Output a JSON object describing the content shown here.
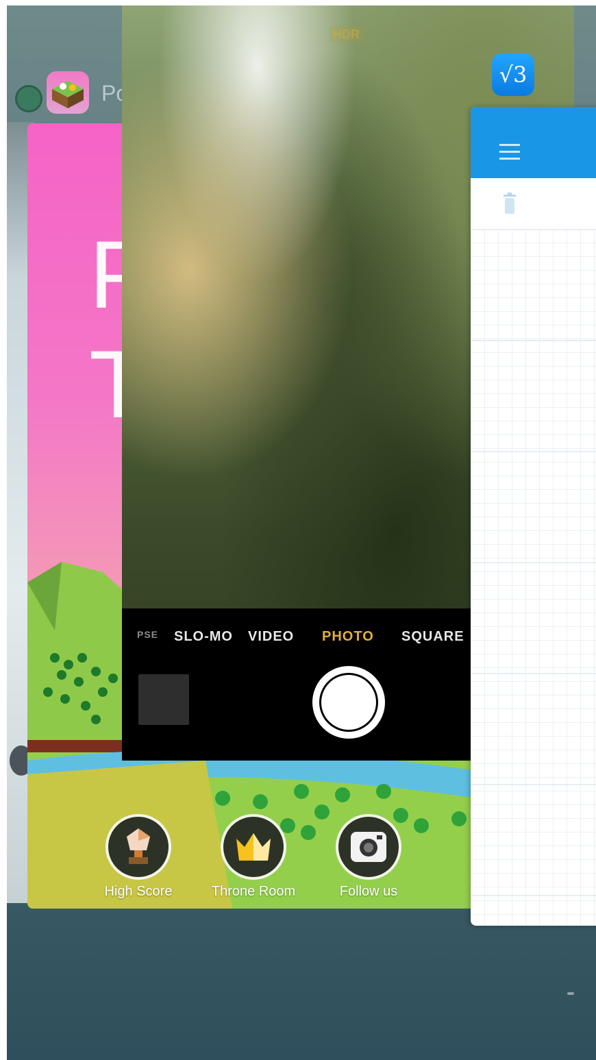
{
  "switcher": {
    "game_app": {
      "name": "Po",
      "title_lines": [
        "P",
        "T"
      ],
      "buttons": [
        {
          "label": "High Score",
          "icon": "trophy-icon"
        },
        {
          "label": "Throne Room",
          "icon": "crown-icon"
        },
        {
          "label": "Follow us",
          "icon": "instagram-icon"
        }
      ]
    },
    "camera_app": {
      "hdr_label": "HDR",
      "modes": [
        "PSE",
        "SLO-MO",
        "VIDEO",
        "PHOTO",
        "SQUARE"
      ],
      "active_mode": "PHOTO"
    },
    "right_app": {
      "icon_text": "√3",
      "icons": [
        "menu-icon",
        "trash-icon"
      ]
    }
  },
  "colors": {
    "camera_active_mode": "#e2b13c",
    "right_app_header": "#1a96e6",
    "game_bg_pink": "#f563c6"
  }
}
